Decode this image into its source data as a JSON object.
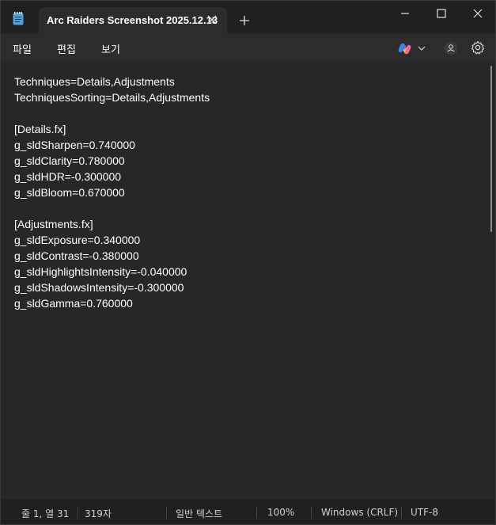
{
  "titlebar": {
    "tab_title": "Arc Raiders Screenshot 2025.12.13",
    "icons": [
      "notepad-icon",
      "close-tab-icon",
      "new-tab-icon",
      "minimize-icon",
      "maximize-icon",
      "close-window-icon"
    ]
  },
  "menubar": {
    "items": [
      "파일",
      "편집",
      "보기"
    ],
    "icons": [
      "copilot-icon",
      "chevron-down-icon",
      "account-icon",
      "settings-icon"
    ]
  },
  "editor": {
    "lines": [
      "Techniques=Details,Adjustments",
      "TechniquesSorting=Details,Adjustments",
      "",
      "[Details.fx]",
      "g_sldSharpen=0.740000",
      "g_sldClarity=0.780000",
      "g_sldHDR=-0.300000",
      "g_sldBloom=0.670000",
      "",
      "[Adjustments.fx]",
      "g_sldExposure=0.340000",
      "g_sldContrast=-0.380000",
      "g_sldHighlightsIntensity=-0.040000",
      "g_sldShadowsIntensity=-0.300000",
      "g_sldGamma=0.760000"
    ]
  },
  "statusbar": {
    "position": "줄 1, 열 31",
    "chars": "319자",
    "format": "일반 텍스트",
    "zoom": "100%",
    "line_ending": "Windows (CRLF)",
    "encoding": "UTF-8"
  },
  "colors": {
    "background": "#272727",
    "titlebar": "#202020",
    "tab": "#2c2c2c",
    "text": "#ffffff"
  }
}
